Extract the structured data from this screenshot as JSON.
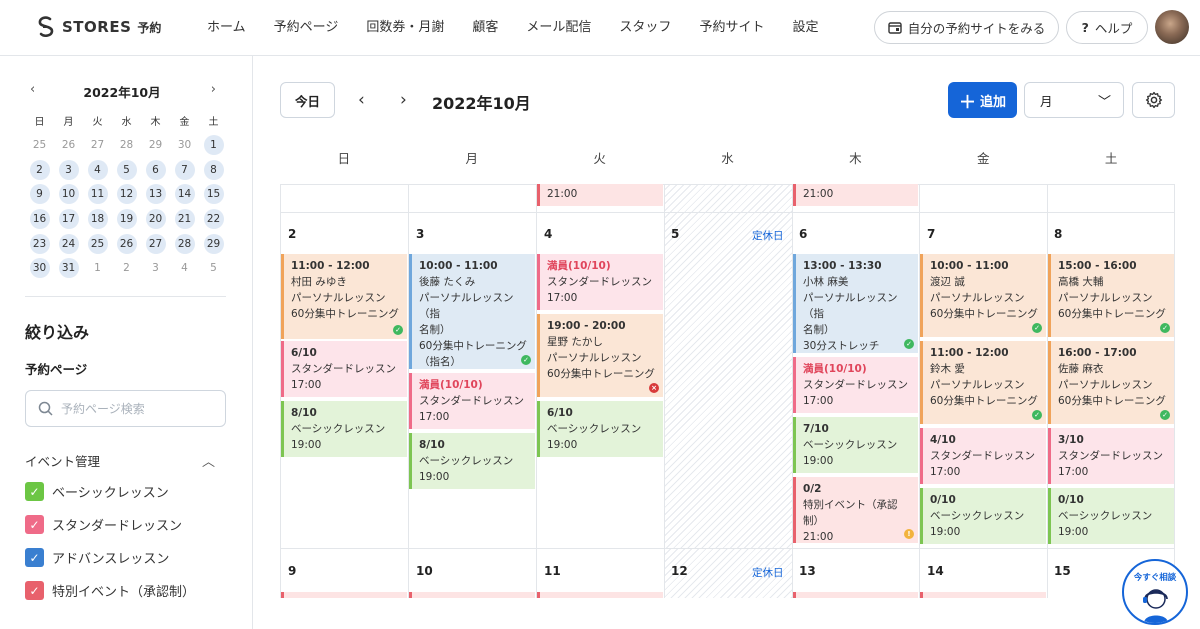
{
  "header": {
    "logo_text": "STORES",
    "logo_sub": "予約",
    "nav": [
      "ホーム",
      "予約ページ",
      "回数券・月謝",
      "顧客",
      "メール配信",
      "スタッフ",
      "予約サイト",
      "設定"
    ],
    "site_button": "自分の予約サイトをみる",
    "help_button": "ヘルプ"
  },
  "mini_cal": {
    "title": "2022年10月",
    "weekdays": [
      "日",
      "月",
      "火",
      "水",
      "木",
      "金",
      "土"
    ],
    "rows": [
      [
        "25",
        "26",
        "27",
        "28",
        "29",
        "30",
        "1"
      ],
      [
        "2",
        "3",
        "4",
        "5",
        "6",
        "7",
        "8"
      ],
      [
        "9",
        "10",
        "11",
        "12",
        "13",
        "14",
        "15"
      ],
      [
        "16",
        "17",
        "18",
        "19",
        "20",
        "21",
        "22"
      ],
      [
        "23",
        "24",
        "25",
        "26",
        "27",
        "28",
        "29"
      ],
      [
        "30",
        "31",
        "1",
        "2",
        "3",
        "4",
        "5"
      ]
    ]
  },
  "filter": {
    "title": "絞り込み",
    "page_label": "予約ページ",
    "search_placeholder": "予約ページ検索",
    "event_mgmt": "イベント管理",
    "checkboxes": [
      {
        "label": "ベーシックレッスン",
        "color": "#6cc644"
      },
      {
        "label": "スタンダードレッスン",
        "color": "#ef6b88"
      },
      {
        "label": "アドバンスレッスン",
        "color": "#3a7fd0"
      },
      {
        "label": "特別イベント（承認制）",
        "color": "#e8616c"
      }
    ]
  },
  "toolbar": {
    "today": "今日",
    "title": "2022年10月",
    "add": "追加",
    "view": "月"
  },
  "weekdays": [
    "日",
    "月",
    "火",
    "水",
    "木",
    "金",
    "土"
  ],
  "calendar": {
    "closed_label": "定休日",
    "prev_row": {
      "tue_time": "21:00",
      "thu_time": "21:00"
    },
    "week2_days": [
      "2",
      "3",
      "4",
      "5",
      "6",
      "7",
      "8"
    ],
    "week3_days": [
      "9",
      "10",
      "11",
      "12",
      "13",
      "14",
      "15"
    ],
    "events": {
      "sun1": {
        "time": "11:00 - 12:00",
        "line1": "村田 みゆき",
        "line2": "パーソナルレッスン",
        "line3": "60分集中トレーニング"
      },
      "sun2": {
        "count": "6/10",
        "name": "スタンダードレッスン",
        "time": "17:00"
      },
      "sun3": {
        "count": "8/10",
        "name": "ベーシックレッスン",
        "time": "19:00"
      },
      "mon1": {
        "time": "10:00 - 11:00",
        "line1": "後藤 たくみ",
        "line2": "パーソナルレッスン（指",
        "line3": "名制）",
        "line4": "60分集中トレーニング",
        "line5": "（指名）"
      },
      "mon2": {
        "count": "満員(10/10)",
        "name": "スタンダードレッスン",
        "time": "17:00"
      },
      "mon3": {
        "count": "8/10",
        "name": "ベーシックレッスン",
        "time": "19:00"
      },
      "tue1": {
        "count": "満員(10/10)",
        "name": "スタンダードレッスン",
        "time": "17:00"
      },
      "tue2": {
        "time": "19:00 - 20:00",
        "line1": "星野 たかし",
        "line2": "パーソナルレッスン",
        "line3": "60分集中トレーニング"
      },
      "tue3": {
        "count": "6/10",
        "name": "ベーシックレッスン",
        "time": "19:00"
      },
      "thu1": {
        "time": "13:00 - 13:30",
        "line1": "小林 麻美",
        "line2": "パーソナルレッスン（指",
        "line3": "名制）",
        "line4": "30分ストレッチ"
      },
      "thu2": {
        "count": "満員(10/10)",
        "name": "スタンダードレッスン",
        "time": "17:00"
      },
      "thu3": {
        "count": "7/10",
        "name": "ベーシックレッスン",
        "time": "19:00"
      },
      "thu4": {
        "count": "0/2",
        "name": "特別イベント（承認制）",
        "time": "21:00"
      },
      "fri1": {
        "time": "10:00 - 11:00",
        "line1": "渡辺 誠",
        "line2": "パーソナルレッスン",
        "line3": "60分集中トレーニング"
      },
      "fri2": {
        "time": "11:00 - 12:00",
        "line1": "鈴木 愛",
        "line2": "パーソナルレッスン",
        "line3": "60分集中トレーニング"
      },
      "fri3": {
        "count": "4/10",
        "name": "スタンダードレッスン",
        "time": "17:00"
      },
      "fri4": {
        "count": "0/10",
        "name": "ベーシックレッスン",
        "time": "19:00"
      },
      "sat1": {
        "time": "15:00 - 16:00",
        "line1": "高橋 大輔",
        "line2": "パーソナルレッスン",
        "line3": "60分集中トレーニング"
      },
      "sat2": {
        "time": "16:00 - 17:00",
        "line1": "佐藤 麻衣",
        "line2": "パーソナルレッスン",
        "line3": "60分集中トレーニング"
      },
      "sat3": {
        "count": "3/10",
        "name": "スタンダードレッスン",
        "time": "17:00"
      },
      "sat4": {
        "count": "0/10",
        "name": "ベーシックレッスン",
        "time": "19:00"
      }
    }
  },
  "chat": {
    "label": "今すぐ相談"
  }
}
